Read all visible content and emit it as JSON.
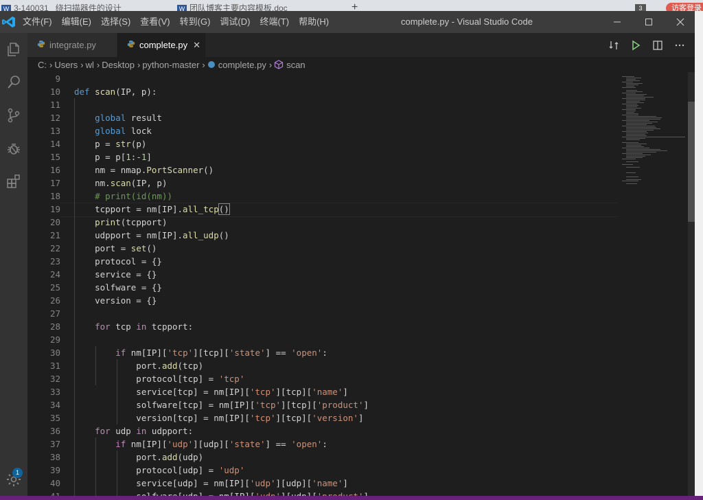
{
  "browser_bg": {
    "tab1": "3-140031_ 绕扫描器件的设计",
    "tab2": "团队博客主要内容模板.doc",
    "badge_num": "3",
    "red_label": "访客登录"
  },
  "titlebar": {
    "menu": [
      "文件(F)",
      "编辑(E)",
      "选择(S)",
      "查看(V)",
      "转到(G)",
      "调试(D)",
      "终端(T)",
      "帮助(H)"
    ],
    "title": "complete.py - Visual Studio Code"
  },
  "tabs": [
    {
      "label": "integrate.py",
      "active": false
    },
    {
      "label": "complete.py",
      "active": true
    }
  ],
  "breadcrumb": [
    "C:",
    "Users",
    "wl",
    "Desktop",
    "python-master",
    "complete.py",
    "scan"
  ],
  "activity_badge": "1",
  "colors": {
    "accent": "#007acc",
    "statusbar": "#68217a",
    "keyword": "#569cd6",
    "control": "#c586c0",
    "string": "#ce9178",
    "function": "#dcdcaa",
    "comment": "#6a9955"
  },
  "icons": [
    "vscode-logo-icon",
    "explorer-icon",
    "search-icon",
    "source-control-icon",
    "debug-icon",
    "extensions-icon",
    "settings-gear-icon",
    "python-file-icon",
    "close-icon",
    "compare-icon",
    "run-icon",
    "split-editor-icon",
    "more-icon",
    "symbol-method-icon"
  ],
  "code": [
    {
      "n": "9",
      "t": []
    },
    {
      "n": "10",
      "t": [
        [
          "kw",
          "def "
        ],
        [
          "fn",
          "scan"
        ],
        [
          "p",
          "(IP, p):"
        ]
      ]
    },
    {
      "n": "11",
      "t": []
    },
    {
      "n": "12",
      "t": [
        [
          "p",
          "    "
        ],
        [
          "kw",
          "global"
        ],
        [
          "p",
          " result"
        ]
      ]
    },
    {
      "n": "13",
      "t": [
        [
          "p",
          "    "
        ],
        [
          "kw",
          "global"
        ],
        [
          "p",
          " lock"
        ]
      ]
    },
    {
      "n": "14",
      "t": [
        [
          "p",
          "    p = "
        ],
        [
          "fn",
          "str"
        ],
        [
          "p",
          "(p)"
        ]
      ]
    },
    {
      "n": "15",
      "t": [
        [
          "p",
          "    p = p["
        ],
        [
          "num",
          "1"
        ],
        [
          "p",
          ":-"
        ],
        [
          "num",
          "1"
        ],
        [
          "p",
          "]"
        ]
      ]
    },
    {
      "n": "16",
      "t": [
        [
          "p",
          "    nm = nmap."
        ],
        [
          "fn",
          "PortScanner"
        ],
        [
          "p",
          "()"
        ]
      ]
    },
    {
      "n": "17",
      "t": [
        [
          "p",
          "    nm."
        ],
        [
          "fn",
          "scan"
        ],
        [
          "p",
          "(IP, p)"
        ]
      ]
    },
    {
      "n": "18",
      "t": [
        [
          "p",
          "    "
        ],
        [
          "cm",
          "# print(id(nm))"
        ]
      ]
    },
    {
      "n": "19",
      "t": [
        [
          "p",
          "    tcpport = nm[IP]."
        ],
        [
          "fn",
          "all_tcp"
        ],
        [
          "br",
          "()"
        ]
      ]
    },
    {
      "n": "20",
      "t": [
        [
          "p",
          "    "
        ],
        [
          "fn",
          "print"
        ],
        [
          "p",
          "(tcpport)"
        ]
      ]
    },
    {
      "n": "21",
      "t": [
        [
          "p",
          "    udpport = nm[IP]."
        ],
        [
          "fn",
          "all_udp"
        ],
        [
          "p",
          "()"
        ]
      ]
    },
    {
      "n": "22",
      "t": [
        [
          "p",
          "    port = "
        ],
        [
          "fn",
          "set"
        ],
        [
          "p",
          "()"
        ]
      ]
    },
    {
      "n": "23",
      "t": [
        [
          "p",
          "    protocol = {}"
        ]
      ]
    },
    {
      "n": "24",
      "t": [
        [
          "p",
          "    service = {}"
        ]
      ]
    },
    {
      "n": "25",
      "t": [
        [
          "p",
          "    solfware = {}"
        ]
      ]
    },
    {
      "n": "26",
      "t": [
        [
          "p",
          "    version = {}"
        ]
      ]
    },
    {
      "n": "27",
      "t": []
    },
    {
      "n": "28",
      "t": [
        [
          "p",
          "    "
        ],
        [
          "ctl",
          "for"
        ],
        [
          "p",
          " tcp "
        ],
        [
          "ctl",
          "in"
        ],
        [
          "p",
          " tcpport:"
        ]
      ]
    },
    {
      "n": "29",
      "t": []
    },
    {
      "n": "30",
      "t": [
        [
          "p",
          "        "
        ],
        [
          "ctl",
          "if"
        ],
        [
          "p",
          " nm[IP]["
        ],
        [
          "str",
          "'tcp'"
        ],
        [
          "p",
          "][tcp]["
        ],
        [
          "str",
          "'state'"
        ],
        [
          "p",
          "] == "
        ],
        [
          "str",
          "'open'"
        ],
        [
          "p",
          ":"
        ]
      ]
    },
    {
      "n": "31",
      "t": [
        [
          "p",
          "            port."
        ],
        [
          "fn",
          "add"
        ],
        [
          "p",
          "(tcp)"
        ]
      ]
    },
    {
      "n": "32",
      "t": [
        [
          "p",
          "            protocol[tcp] = "
        ],
        [
          "str",
          "'tcp'"
        ]
      ]
    },
    {
      "n": "33",
      "t": [
        [
          "p",
          "            service[tcp] = nm[IP]["
        ],
        [
          "str",
          "'tcp'"
        ],
        [
          "p",
          "][tcp]["
        ],
        [
          "str",
          "'name'"
        ],
        [
          "p",
          "]"
        ]
      ]
    },
    {
      "n": "34",
      "t": [
        [
          "p",
          "            solfware[tcp] = nm[IP]["
        ],
        [
          "str",
          "'tcp'"
        ],
        [
          "p",
          "][tcp]["
        ],
        [
          "str",
          "'product'"
        ],
        [
          "p",
          "]"
        ]
      ]
    },
    {
      "n": "35",
      "t": [
        [
          "p",
          "            version[tcp] = nm[IP]["
        ],
        [
          "str",
          "'tcp'"
        ],
        [
          "p",
          "][tcp]["
        ],
        [
          "str",
          "'version'"
        ],
        [
          "p",
          "]"
        ]
      ]
    },
    {
      "n": "36",
      "t": [
        [
          "p",
          "    "
        ],
        [
          "ctl",
          "for"
        ],
        [
          "p",
          " udp "
        ],
        [
          "ctl",
          "in"
        ],
        [
          "p",
          " udpport:"
        ]
      ]
    },
    {
      "n": "37",
      "t": [
        [
          "p",
          "        "
        ],
        [
          "ctl",
          "if"
        ],
        [
          "p",
          " nm[IP]["
        ],
        [
          "str",
          "'udp'"
        ],
        [
          "p",
          "][udp]["
        ],
        [
          "str",
          "'state'"
        ],
        [
          "p",
          "] == "
        ],
        [
          "str",
          "'open'"
        ],
        [
          "p",
          ":"
        ]
      ]
    },
    {
      "n": "38",
      "t": [
        [
          "p",
          "            port."
        ],
        [
          "fn",
          "add"
        ],
        [
          "p",
          "(udp)"
        ]
      ]
    },
    {
      "n": "39",
      "t": [
        [
          "p",
          "            protocol[udp] = "
        ],
        [
          "str",
          "'udp'"
        ]
      ]
    },
    {
      "n": "40",
      "t": [
        [
          "p",
          "            service[udp] = nm[IP]["
        ],
        [
          "str",
          "'udp'"
        ],
        [
          "p",
          "][udp]["
        ],
        [
          "str",
          "'name'"
        ],
        [
          "p",
          "]"
        ]
      ]
    },
    {
      "n": "41",
      "t": [
        [
          "p",
          "            solfware[udp] = nm[IP]["
        ],
        [
          "str",
          "'udp'"
        ],
        [
          "p",
          "][udp]["
        ],
        [
          "str",
          "'product'"
        ],
        [
          "p",
          "]"
        ]
      ]
    }
  ]
}
